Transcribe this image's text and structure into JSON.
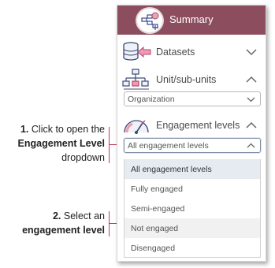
{
  "panel": {
    "summary_label": "Summary",
    "sections": [
      {
        "label": "Datasets",
        "icon": "datasets-icon",
        "state": "collapsed"
      },
      {
        "label": "Unit/sub-units",
        "icon": "org-chart-icon",
        "state": "expanded"
      },
      {
        "label": "Engagement levels",
        "icon": "gauge-icon",
        "state": "expanded"
      }
    ],
    "unit_select_value": "Organization",
    "engagement_select_value": "All engagement levels",
    "engagement_options": [
      "All engagement levels",
      "Fully engaged",
      "Semi-engaged",
      "Not engaged",
      "Disengaged"
    ]
  },
  "callouts": {
    "step1": {
      "number": "1.",
      "text_a": "Click to open the",
      "bold": "Engagement Level",
      "text_b": "dropdown"
    },
    "step2": {
      "number": "2.",
      "text_a": "Select an",
      "bold": "engagement level"
    }
  },
  "colors": {
    "header": "#8c4e5e",
    "accent_line": "#c0395c",
    "selected_bg": "#e6ebf1"
  }
}
